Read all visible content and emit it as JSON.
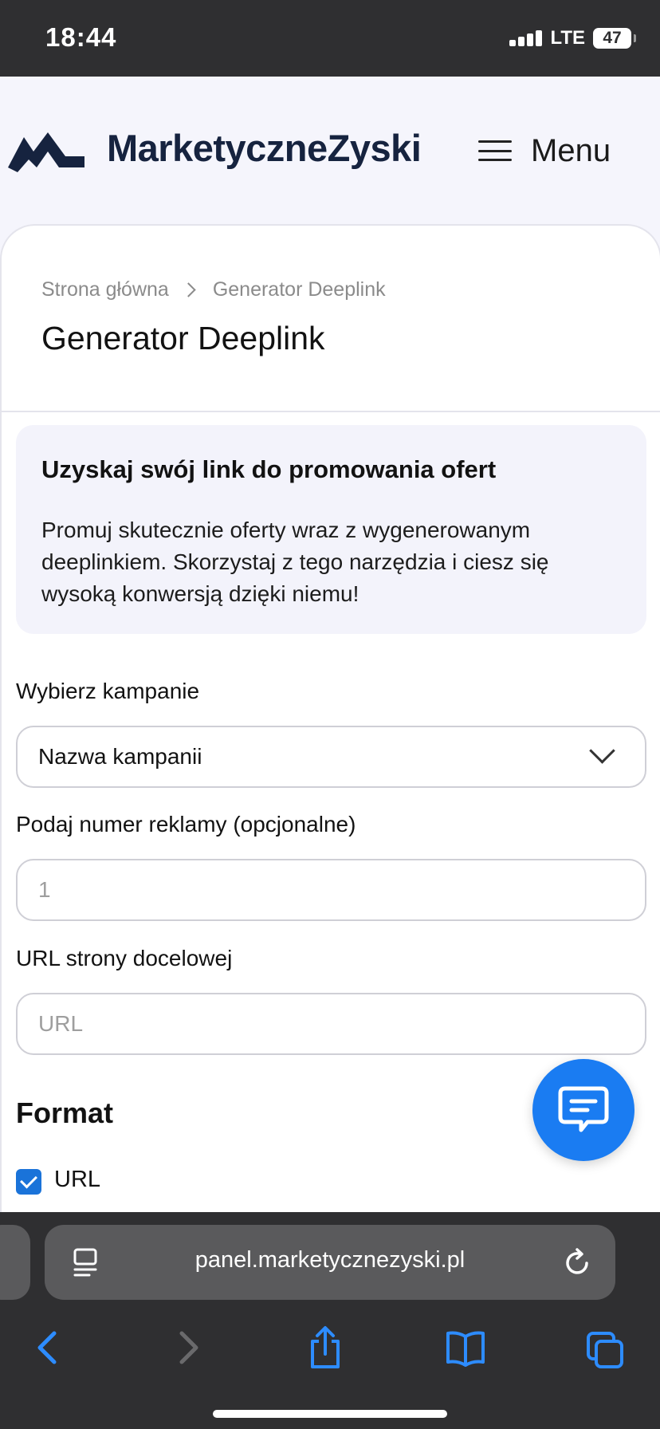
{
  "status_bar": {
    "time": "18:44",
    "network": "LTE",
    "battery": "47"
  },
  "header": {
    "logo_text": "MarketyczneZyski",
    "menu_label": "Menu"
  },
  "breadcrumb": {
    "home": "Strona główna",
    "current": "Generator Deeplink"
  },
  "page_title": "Generator Deeplink",
  "info": {
    "title": "Uzyskaj swój link do promowania ofert",
    "text": "Promuj skutecznie oferty wraz z wygenerowanym deeplinkiem. Skorzystaj z tego narzędzia i ciesz się wysoką konwersją dzięki niemu!"
  },
  "form": {
    "campaign_label": "Wybierz kampanie",
    "campaign_value": "Nazwa kampanii",
    "ad_number_label": "Podaj numer reklamy (opcjonalne)",
    "ad_number_placeholder": "1",
    "url_label": "URL strony docelowej",
    "url_placeholder": "URL",
    "format_title": "Format",
    "format_option": "URL",
    "format_checked": true
  },
  "browser": {
    "url": "panel.marketycznezyski.pl"
  },
  "colors": {
    "accent": "#1a7cf2",
    "checkbox": "#1a73d9",
    "logo": "#16233f",
    "chrome": "#2f2f31"
  },
  "icons": [
    "signal-icon",
    "battery-icon",
    "logo-mark-icon",
    "hamburger-icon",
    "chevron-right-icon",
    "chevron-down-icon",
    "check-icon",
    "chat-icon",
    "reader-icon",
    "reload-icon",
    "back-icon",
    "forward-icon",
    "share-icon",
    "bookmarks-icon",
    "tabs-icon"
  ]
}
